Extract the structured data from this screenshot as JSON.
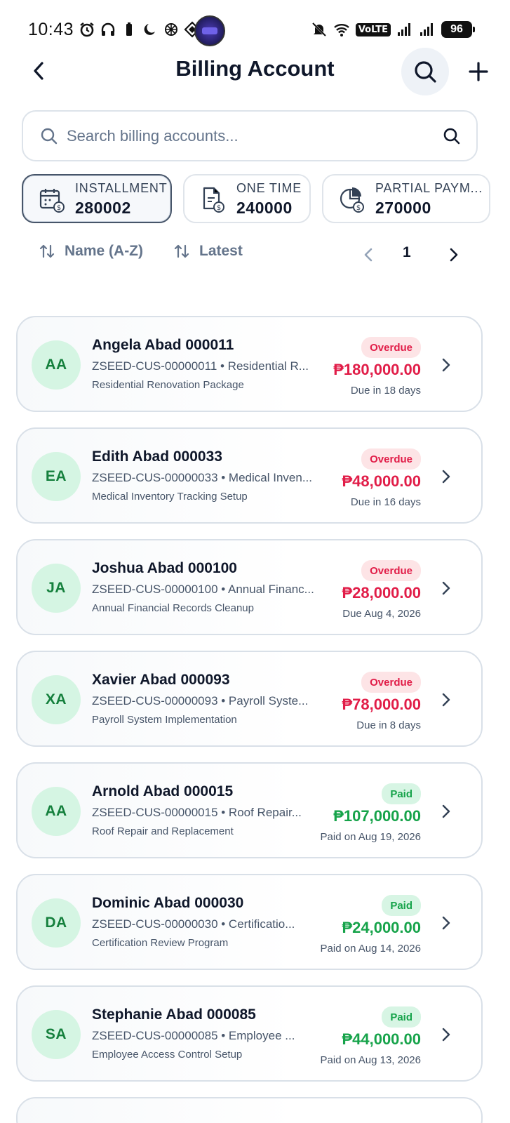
{
  "status_bar": {
    "time": "10:43",
    "network": "VoLTE",
    "battery": "96"
  },
  "header": {
    "title": "Billing Account"
  },
  "search": {
    "placeholder": "Search billing accounts..."
  },
  "chips": [
    {
      "label": "INSTALLMENT",
      "count": "280002",
      "icon": "calendar-dollar-icon",
      "active": true
    },
    {
      "label": "ONE TIME",
      "count": "240000",
      "icon": "document-dollar-icon",
      "active": false
    },
    {
      "label": "PARTIAL PAYM...",
      "count": "270000",
      "icon": "pie-dollar-icon",
      "active": false
    }
  ],
  "sort": {
    "name_label": "Name (A-Z)",
    "latest_label": "Latest",
    "page": "1"
  },
  "accounts": [
    {
      "initials": "AA",
      "name": "Angela Abad 000011",
      "sub": "ZSEED-CUS-00000011 • Residential R...",
      "desc": "Residential Renovation Package",
      "status": "Overdue",
      "amount": "₱180,000.00",
      "due": "Due in 18 days"
    },
    {
      "initials": "EA",
      "name": "Edith Abad 000033",
      "sub": "ZSEED-CUS-00000033 • Medical Inven...",
      "desc": "Medical Inventory Tracking Setup",
      "status": "Overdue",
      "amount": "₱48,000.00",
      "due": "Due in 16 days"
    },
    {
      "initials": "JA",
      "name": "Joshua Abad 000100",
      "sub": "ZSEED-CUS-00000100 • Annual Financ...",
      "desc": "Annual Financial Records Cleanup",
      "status": "Overdue",
      "amount": "₱28,000.00",
      "due": "Due Aug 4, 2026"
    },
    {
      "initials": "XA",
      "name": "Xavier Abad 000093",
      "sub": "ZSEED-CUS-00000093 • Payroll Syste...",
      "desc": "Payroll System Implementation",
      "status": "Overdue",
      "amount": "₱78,000.00",
      "due": "Due in 8 days"
    },
    {
      "initials": "AA",
      "name": "Arnold Abad 000015",
      "sub": "ZSEED-CUS-00000015 • Roof Repair...",
      "desc": "Roof Repair and Replacement",
      "status": "Paid",
      "amount": "₱107,000.00",
      "due": "Paid on Aug 19, 2026"
    },
    {
      "initials": "DA",
      "name": "Dominic Abad 000030",
      "sub": "ZSEED-CUS-00000030 • Certificatio...",
      "desc": "Certification Review Program",
      "status": "Paid",
      "amount": "₱24,000.00",
      "due": "Paid on Aug 14, 2026"
    },
    {
      "initials": "SA",
      "name": "Stephanie Abad 000085",
      "sub": "ZSEED-CUS-00000085 • Employee ...",
      "desc": "Employee Access Control Setup",
      "status": "Paid",
      "amount": "₱44,000.00",
      "due": "Paid on Aug 13, 2026"
    }
  ],
  "colors": {
    "overdue": "#e11d48",
    "paid": "#16a34a",
    "avatar_bg": "#d5f5e3"
  }
}
